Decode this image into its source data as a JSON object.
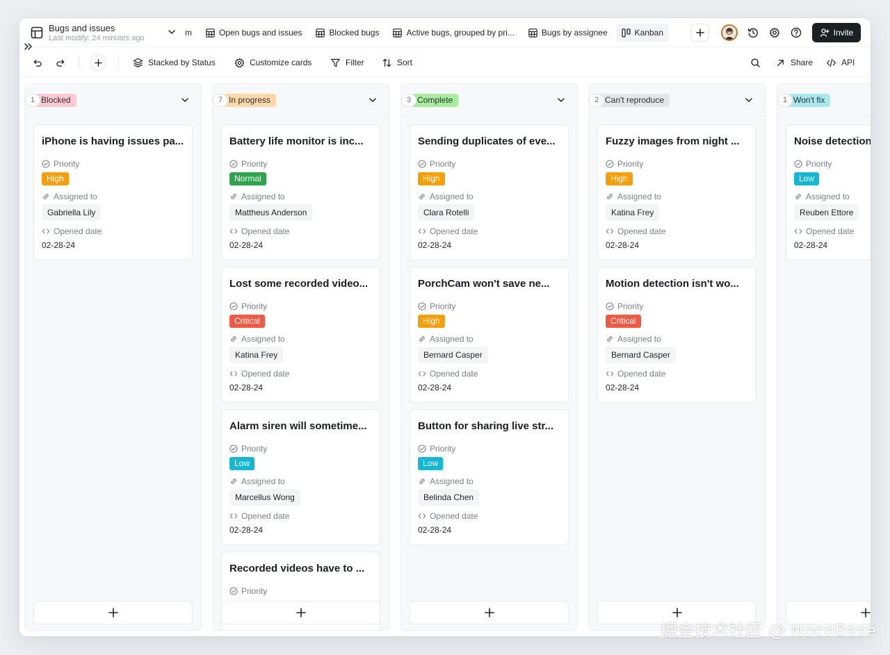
{
  "header": {
    "title": "Bugs and issues",
    "subtitle": "Last modify: 24 minutes ago",
    "tabs": [
      {
        "label": "m",
        "icon": "grid-icon",
        "active": false
      },
      {
        "label": "Open bugs and issues",
        "icon": "grid-icon",
        "active": false
      },
      {
        "label": "Blocked bugs",
        "icon": "grid-icon",
        "active": false
      },
      {
        "label": "Active bugs, grouped by pri...",
        "icon": "grid-icon",
        "active": false
      },
      {
        "label": "Bugs by assignee",
        "icon": "grid-icon",
        "active": false
      },
      {
        "label": "Kanban",
        "icon": "kanban-icon",
        "active": true
      }
    ],
    "invite_label": "Invite"
  },
  "toolbar": {
    "stacked_label": "Stacked by Status",
    "customize_label": "Customize cards",
    "filter_label": "Filter",
    "sort_label": "Sort",
    "share_label": "Share",
    "api_label": "API"
  },
  "labels": {
    "priority": "Priority",
    "assigned": "Assigned to",
    "opened": "Opened date"
  },
  "colors": {
    "High": "#f5a00b",
    "Normal": "#2ea44f",
    "Critical": "#ef5a45",
    "Low": "#14b8d4"
  },
  "columns": [
    {
      "tag": "Blocked",
      "tag_color": "#ffc9d2",
      "count": "1",
      "cards": [
        {
          "title": "iPhone is having issues pa...",
          "priority": "High",
          "assignee": "Gabriella Lily",
          "date": "02-28-24"
        }
      ]
    },
    {
      "tag": "In progress",
      "tag_color": "#ffd8a8",
      "count": "7",
      "cards": [
        {
          "title": "Battery life monitor is inc...",
          "priority": "Normal",
          "assignee": "Mattheus Anderson",
          "date": "02-28-24"
        },
        {
          "title": "Lost some recorded video...",
          "priority": "Critical",
          "assignee": "Katina Frey",
          "date": "02-28-24"
        },
        {
          "title": "Alarm siren will sometime...",
          "priority": "Low",
          "assignee": "Marcellus Wong",
          "date": "02-28-24"
        },
        {
          "title": "Recorded videos have to ...",
          "priority": "",
          "assignee": "",
          "date": ""
        }
      ]
    },
    {
      "tag": "Complete",
      "tag_color": "#a7ed9d",
      "count": "3",
      "cards": [
        {
          "title": "Sending duplicates of eve...",
          "priority": "High",
          "assignee": "Clara Rotelli",
          "date": "02-28-24"
        },
        {
          "title": "PorchCam won't save ne...",
          "priority": "High",
          "assignee": "Bernard Casper",
          "date": "02-28-24"
        },
        {
          "title": "Button for sharing live str...",
          "priority": "Low",
          "assignee": "Belinda Chen",
          "date": "02-28-24"
        }
      ]
    },
    {
      "tag": "Can't reproduce",
      "tag_color": "#e3e5e8",
      "count": "2",
      "cards": [
        {
          "title": "Fuzzy images from night ...",
          "priority": "High",
          "assignee": "Katina Frey",
          "date": "02-28-24"
        },
        {
          "title": "Motion detection isn't wo...",
          "priority": "Critical",
          "assignee": "Bernard Casper",
          "date": "02-28-24"
        }
      ]
    },
    {
      "tag": "Won't fix",
      "tag_color": "#a8e9ee",
      "count": "1",
      "cards": [
        {
          "title": "Noise detection",
          "priority": "Low",
          "assignee": "Reuben Ettore",
          "date": "02-28-24"
        }
      ]
    }
  ],
  "watermark": "掘金技术社区 @ NocoBase"
}
